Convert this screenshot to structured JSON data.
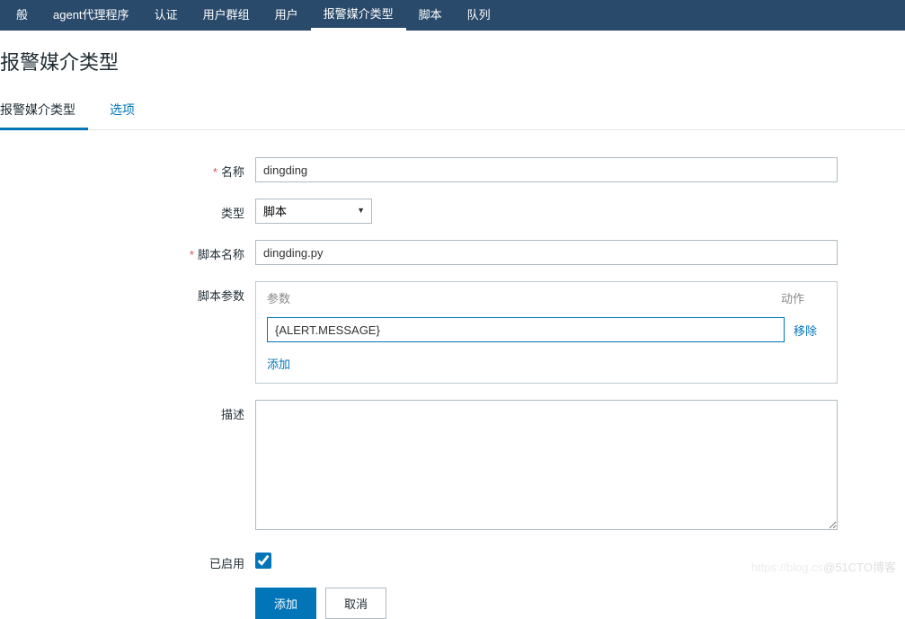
{
  "nav": {
    "items": [
      {
        "label": "般"
      },
      {
        "label": "agent代理程序"
      },
      {
        "label": "认证"
      },
      {
        "label": "用户群组"
      },
      {
        "label": "用户"
      },
      {
        "label": "报警媒介类型",
        "active": true
      },
      {
        "label": "脚本"
      },
      {
        "label": "队列"
      }
    ]
  },
  "page": {
    "title": "报警媒介类型"
  },
  "tabs": {
    "items": [
      {
        "label": "报警媒介类型",
        "active": true
      },
      {
        "label": "选项"
      }
    ]
  },
  "form": {
    "name_label": "名称",
    "name_value": "dingding",
    "type_label": "类型",
    "type_value": "脚本",
    "type_options": [
      "脚本"
    ],
    "script_name_label": "脚本名称",
    "script_name_value": "dingding.py",
    "script_params_label": "脚本参数",
    "params_header_param": "参数",
    "params_header_action": "动作",
    "params": [
      {
        "value": "{ALERT.MESSAGE}"
      }
    ],
    "remove_label": "移除",
    "add_param_label": "添加",
    "description_label": "描述",
    "description_value": "",
    "enabled_label": "已启用",
    "enabled_value": true,
    "submit_label": "添加",
    "cancel_label": "取消"
  },
  "watermark": {
    "url": "https://blog.cs",
    "text": "@51CTO博客"
  }
}
